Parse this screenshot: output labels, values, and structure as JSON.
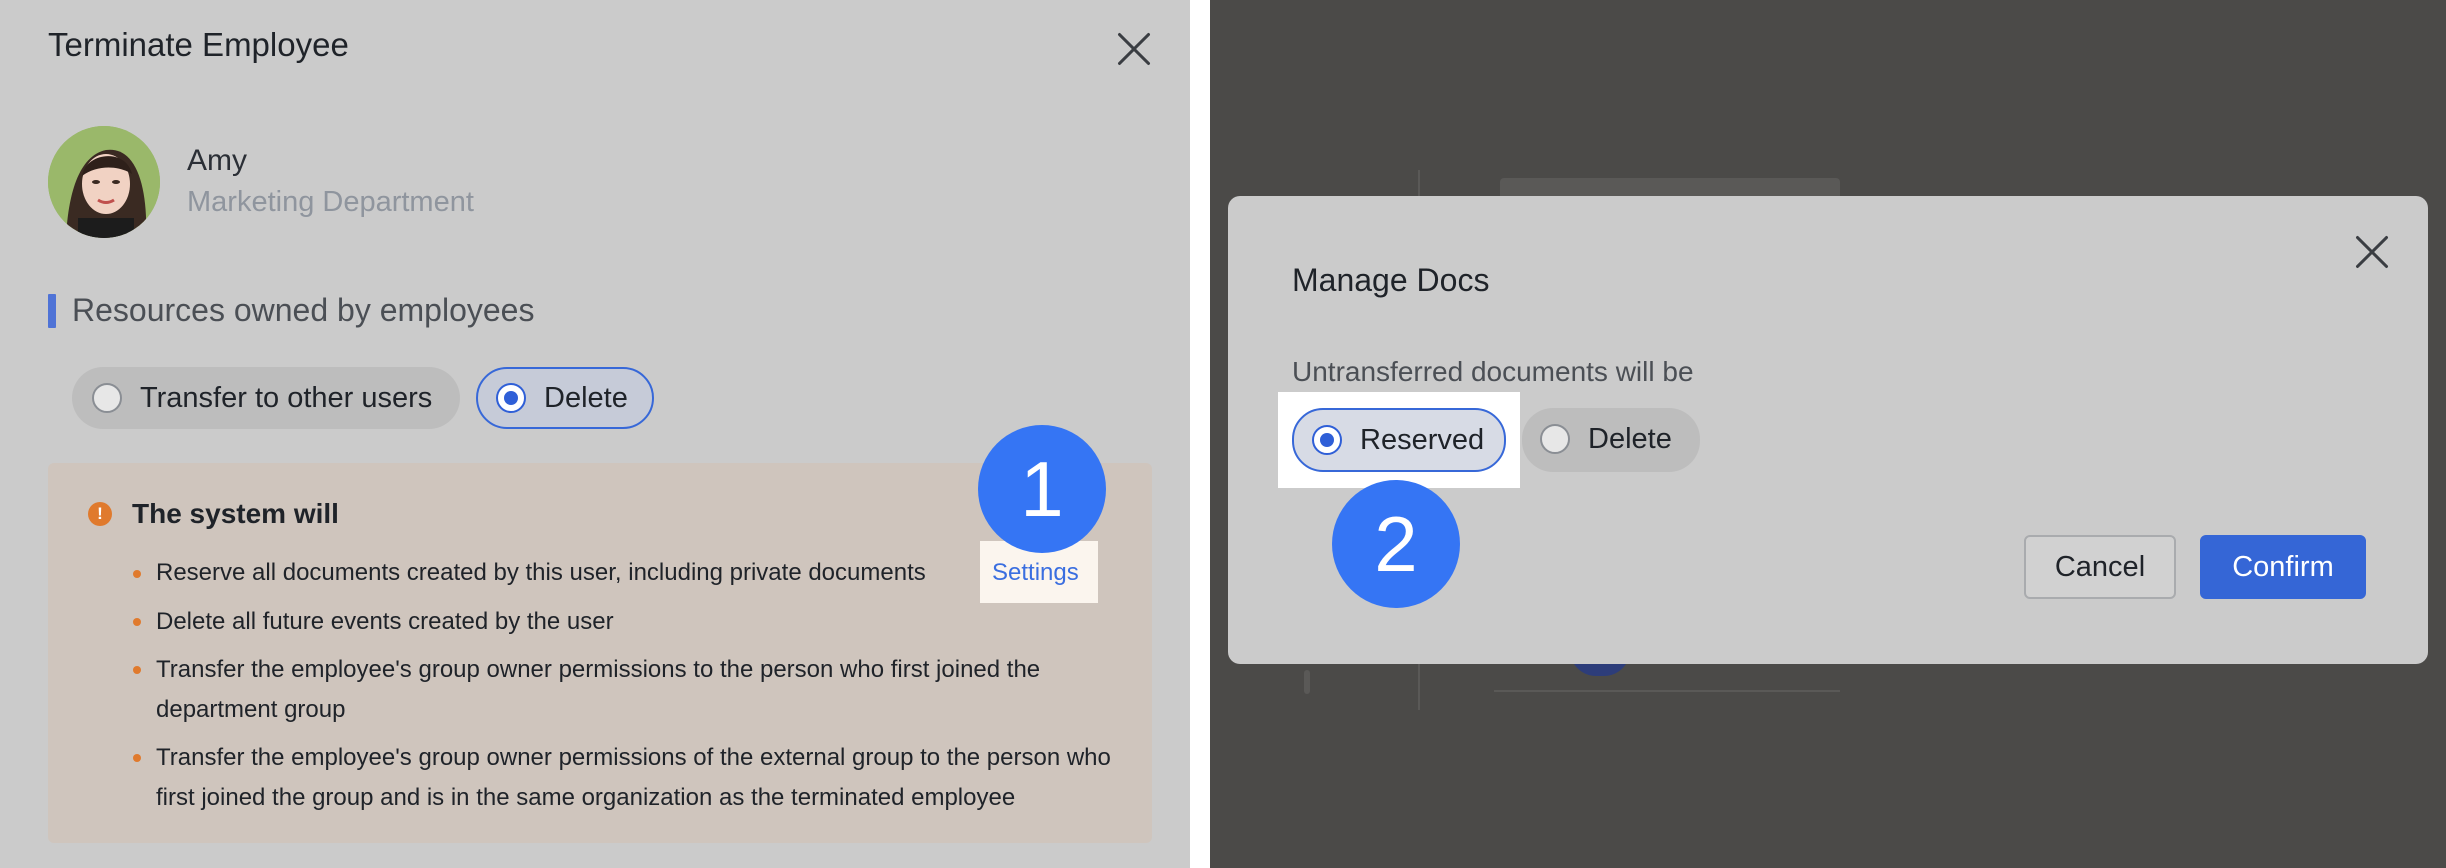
{
  "left_panel": {
    "title": "Terminate Employee",
    "employee": {
      "name": "Amy",
      "department": "Marketing Department"
    },
    "section_title": "Resources owned by employees",
    "options": [
      {
        "label": "Transfer to other users",
        "selected": false
      },
      {
        "label": "Delete",
        "selected": true
      }
    ],
    "notice": {
      "title": "The system will",
      "items": [
        "Reserve all documents created by this user, including private documents",
        "Delete all future events created by the user",
        "Transfer the employee's group owner permissions to the person who first joined the department group",
        "Transfer the employee's group owner permissions of the external group to the person who first joined the group and is in the same organization as the terminated employee"
      ],
      "settings_link": "Settings"
    },
    "step_badge": "1"
  },
  "right_panel": {
    "modal": {
      "title": "Manage Docs",
      "subtitle": "Untransferred documents will be",
      "options": [
        {
          "label": "Reserved",
          "selected": true
        },
        {
          "label": "Delete",
          "selected": false
        }
      ],
      "cancel_label": "Cancel",
      "confirm_label": "Confirm"
    },
    "step_badge": "2"
  },
  "colors": {
    "accent": "#3566d6",
    "badge": "#3575f4",
    "warning": "#e07a2d",
    "dim_overlay": "#4b4a48"
  }
}
